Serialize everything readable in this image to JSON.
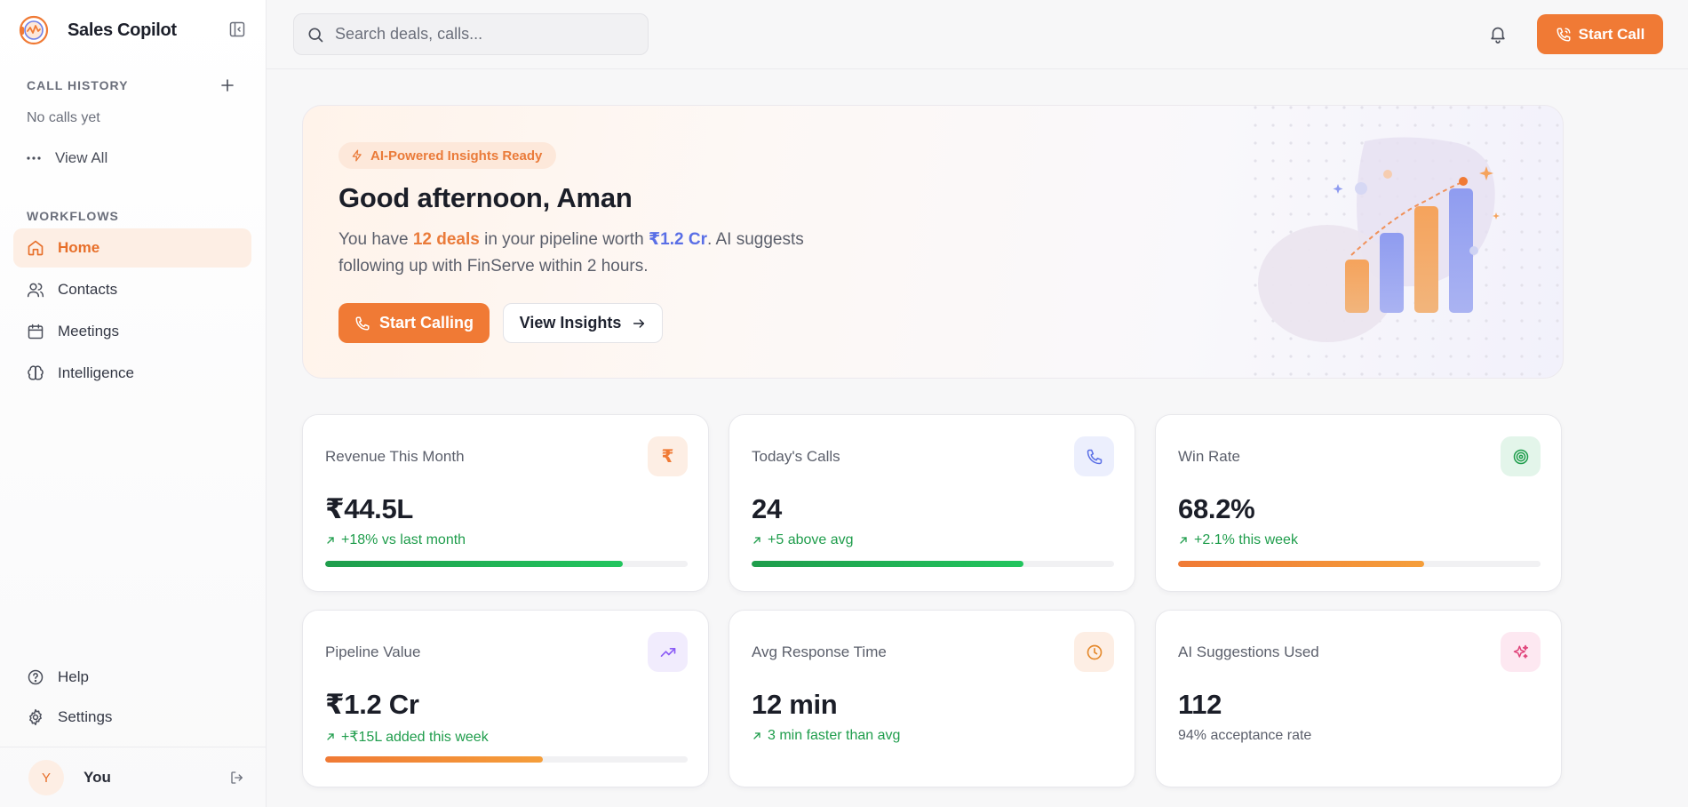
{
  "app": {
    "name": "Sales Copilot"
  },
  "sidebar": {
    "call_history_label": "CALL HISTORY",
    "no_calls": "No calls yet",
    "view_all": "View All",
    "workflows_label": "WORKFLOWS",
    "items": [
      {
        "label": "Home",
        "icon": "home-icon",
        "active": true
      },
      {
        "label": "Contacts",
        "icon": "contacts-icon",
        "active": false
      },
      {
        "label": "Meetings",
        "icon": "calendar-icon",
        "active": false
      },
      {
        "label": "Intelligence",
        "icon": "brain-icon",
        "active": false
      }
    ],
    "help": "Help",
    "settings": "Settings",
    "user": {
      "initial": "Y",
      "name": "You"
    }
  },
  "topbar": {
    "search_placeholder": "Search deals, calls...",
    "start_call": "Start Call"
  },
  "hero": {
    "badge": "AI-Powered Insights Ready",
    "title": "Good afternoon, Aman",
    "text_1": "You have ",
    "deals": "12 deals",
    "text_2": " in your pipeline worth ",
    "worth": "₹1.2 Cr",
    "text_3": ". AI suggests following up with FinServe within 2 hours.",
    "primary_button": "Start Calling",
    "secondary_button": "View Insights"
  },
  "stats": [
    {
      "label": "Revenue This Month",
      "value": "₹44.5L",
      "delta": "+18% vs last month",
      "progress": 0.82,
      "icon": "rupee-icon"
    },
    {
      "label": "Today's Calls",
      "value": "24",
      "delta": "+5 above avg",
      "progress": 0.75,
      "icon": "phone-icon"
    },
    {
      "label": "Win Rate",
      "value": "68.2%",
      "delta": "+2.1% this week",
      "progress": 0.68,
      "icon": "target-icon"
    },
    {
      "label": "Pipeline Value",
      "value": "₹1.2 Cr",
      "delta": "+₹15L added this week",
      "progress": 0.6,
      "icon": "trending-up-icon"
    },
    {
      "label": "Avg Response Time",
      "value": "12 min",
      "delta": "3 min faster than avg",
      "icon": "clock-icon"
    },
    {
      "label": "AI Suggestions Used",
      "value": "112",
      "delta": "94% acceptance rate",
      "icon": "sparkles-icon"
    }
  ],
  "colors": {
    "accent": "#f07a35",
    "green": "#22c55e",
    "orange_bar": "#f59e3a",
    "blue_highlight": "#5a6fe6"
  }
}
